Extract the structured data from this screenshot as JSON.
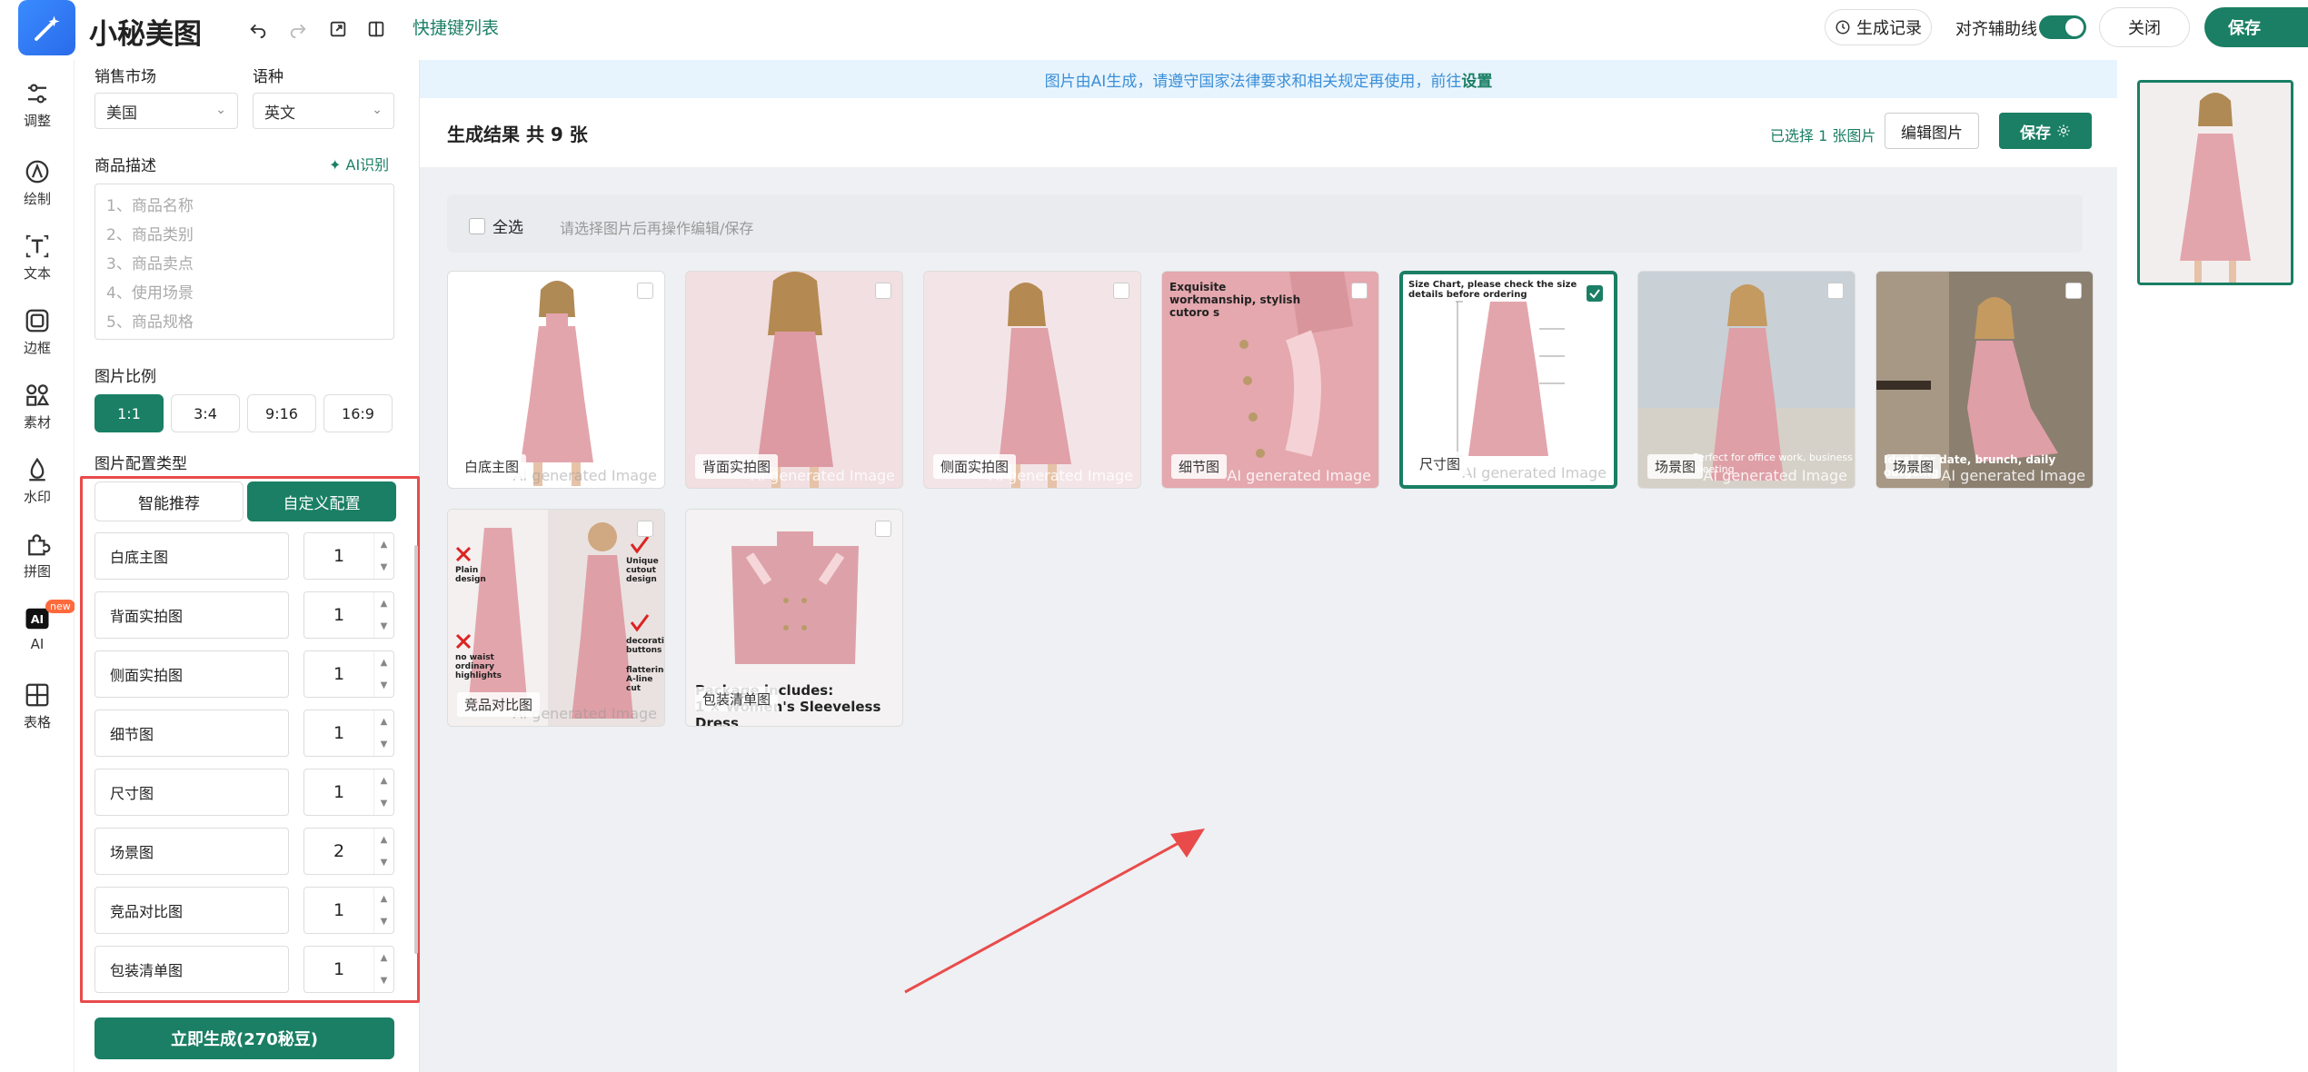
{
  "app": {
    "title": "小秘美图",
    "shortcut_list": "快捷键列表"
  },
  "topbar": {
    "history": "生成记录",
    "align_guides": "对齐辅助线",
    "close": "关闭",
    "save": "保存"
  },
  "nav": [
    {
      "label": "调整",
      "icon": "adjust-icon"
    },
    {
      "label": "绘制",
      "icon": "draw-icon"
    },
    {
      "label": "文本",
      "icon": "text-icon"
    },
    {
      "label": "边框",
      "icon": "border-icon"
    },
    {
      "label": "素材",
      "icon": "material-icon"
    },
    {
      "label": "水印",
      "icon": "watermark-icon"
    },
    {
      "label": "拼图",
      "icon": "puzzle-icon"
    },
    {
      "label": "AI",
      "icon": "ai-icon",
      "badge": "new"
    },
    {
      "label": "表格",
      "icon": "table-icon"
    }
  ],
  "panel": {
    "market_label": "销售市场",
    "language_label": "语种",
    "market_value": "美国",
    "language_value": "英文",
    "desc_label": "商品描述",
    "ai_detect": "AI识别",
    "desc_placeholder": [
      "1、商品名称",
      "2、商品类别",
      "3、商品卖点",
      "4、使用场景",
      "5、商品规格"
    ],
    "ratio_label": "图片比例",
    "ratios": [
      "1:1",
      "3:4",
      "9:16",
      "16:9"
    ],
    "config_type_label": "图片配置类型",
    "config_tabs": [
      "智能推荐",
      "自定义配置"
    ],
    "config_rows": [
      {
        "name": "白底主图",
        "count": "1"
      },
      {
        "name": "背面实拍图",
        "count": "1"
      },
      {
        "name": "侧面实拍图",
        "count": "1"
      },
      {
        "name": "细节图",
        "count": "1"
      },
      {
        "name": "尺寸图",
        "count": "1"
      },
      {
        "name": "场景图",
        "count": "2"
      },
      {
        "name": "竞品对比图",
        "count": "1"
      },
      {
        "name": "包装清单图",
        "count": "1"
      }
    ],
    "generate": "立即生成(270秘豆)"
  },
  "main": {
    "notice_text": "图片由AI生成，请遵守国家法律要求和相关规定再使用，前往",
    "notice_link": "设置",
    "results_title": "生成结果 共 9 张",
    "selected_info": "已选择 1 张图片",
    "edit": "编辑图片",
    "save": "保存",
    "select_all": "全选",
    "select_hint": "请选择图片后再操作编辑/保存",
    "watermark": "AI generated Image",
    "cards": [
      {
        "tag": "白底主图"
      },
      {
        "tag": "背面实拍图"
      },
      {
        "tag": "侧面实拍图"
      },
      {
        "tag": "细节图",
        "overlay": "Exquisite workmanship, stylish cutoro s"
      },
      {
        "tag": "尺寸图",
        "overlay": "Size Chart, please check the size details before ordering",
        "selected": true
      },
      {
        "tag": "场景图",
        "overlay": "Perfect for office work, business meeting"
      },
      {
        "tag": "场景图",
        "overlay": "Ideal for date, brunch, daily outgoing"
      },
      {
        "tag": "竞品对比图",
        "overlay": "Plain design",
        "overlay2": "Unique cutout design",
        "overlay3": "no waist ordinary highlights",
        "overlay4": "decorative buttons",
        "overlay5": "flattering A-line cut"
      },
      {
        "tag": "包装清单图",
        "overlay": "Package includes:",
        "overlay2": "1 × Women's Sleeveless Dress"
      }
    ]
  }
}
